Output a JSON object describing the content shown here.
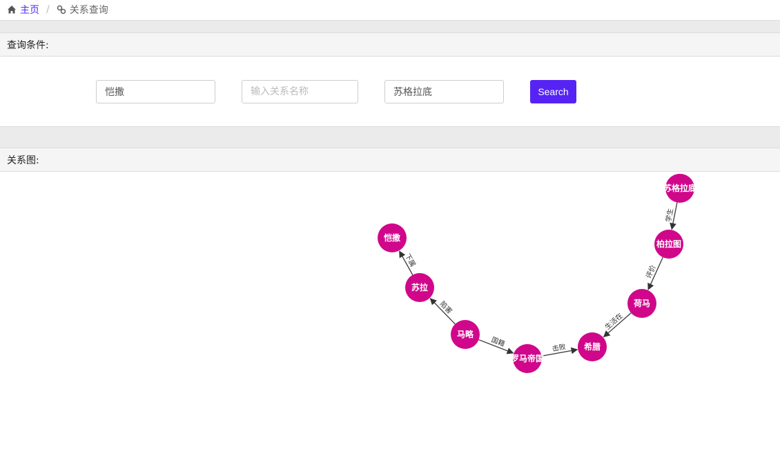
{
  "breadcrumb": {
    "home": "主页",
    "sep": "/",
    "current": "关系查询"
  },
  "query": {
    "title": "查询条件:",
    "entity1": {
      "value": "恺撒",
      "placeholder": ""
    },
    "relation": {
      "value": "",
      "placeholder": "输入关系名称"
    },
    "entity2": {
      "value": "苏格拉底",
      "placeholder": ""
    },
    "search_label": "Search"
  },
  "graph": {
    "title": "关系图:",
    "node_color": "#d0078a",
    "nodes": [
      {
        "id": "n1",
        "label": "苏格拉底"
      },
      {
        "id": "n2",
        "label": "柏拉图"
      },
      {
        "id": "n3",
        "label": "荷马"
      },
      {
        "id": "n4",
        "label": "希腊"
      },
      {
        "id": "n5",
        "label": "罗马帝国"
      },
      {
        "id": "n6",
        "label": "马略"
      },
      {
        "id": "n7",
        "label": "苏拉"
      },
      {
        "id": "n8",
        "label": "恺撒"
      }
    ],
    "edges": [
      {
        "from": "n1",
        "to": "n2",
        "label": "学生"
      },
      {
        "from": "n2",
        "to": "n3",
        "label": "评价"
      },
      {
        "from": "n3",
        "to": "n4",
        "label": "生活在"
      },
      {
        "from": "n5",
        "to": "n4",
        "label": "击败"
      },
      {
        "from": "n6",
        "to": "n5",
        "label": "国籍"
      },
      {
        "from": "n6",
        "to": "n7",
        "label": "陷害"
      },
      {
        "from": "n7",
        "to": "n8",
        "label": "下属"
      }
    ]
  }
}
